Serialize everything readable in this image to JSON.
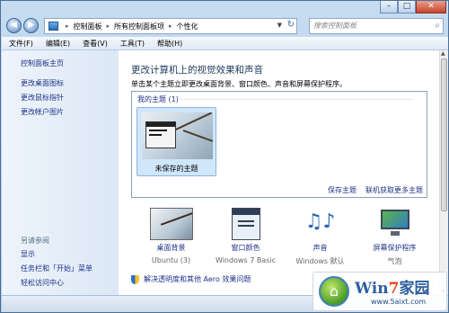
{
  "window": {
    "buttons": {
      "minimize": "–",
      "maximize": "□",
      "close": "✕"
    }
  },
  "address_bar": {
    "segments": [
      "控制面板",
      "所有控制面板项",
      "个性化"
    ],
    "separator": "▸",
    "refresh": "↻",
    "dropdown": "▼"
  },
  "nav": {
    "back": "◀",
    "forward": "▶"
  },
  "search": {
    "placeholder": "搜索控制面板",
    "icon": "⌕"
  },
  "menu": [
    "文件(F)",
    "编辑(E)",
    "查看(V)",
    "工具(T)",
    "帮助(H)"
  ],
  "sidebar": {
    "links": [
      "控制面板主页",
      "更改桌面图标",
      "更改鼠标指针",
      "更改帐户图片"
    ],
    "see_also": {
      "heading": "另请参阅",
      "links": [
        "显示",
        "任务栏和「开始」菜单",
        "轻松访问中心"
      ]
    }
  },
  "main": {
    "title": "更改计算机上的视觉效果和声音",
    "description": "单击某个主题立即更改桌面背景、窗口颜色、声音和屏幕保护程序。",
    "themes": {
      "group_label": "我的主题 (1)",
      "items": [
        {
          "label": "未保存的主题",
          "selected": true
        }
      ],
      "save_link": "保存主题",
      "more_link": "联机获取更多主题"
    },
    "settings": [
      {
        "title": "桌面背景",
        "value": "Ubuntu (3)",
        "icon": "desktop-background-icon"
      },
      {
        "title": "窗口颜色",
        "value": "Windows 7 Basic",
        "icon": "window-color-icon"
      },
      {
        "title": "声音",
        "value": "Windows 默认",
        "icon": "sounds-icon"
      },
      {
        "title": "屏幕保护程序",
        "value": "气泡",
        "icon": "screensaver-icon"
      }
    ],
    "troubleshoot_link": "解决透明度和其他 Aero 效果问题"
  },
  "watermark": {
    "brand_prefix": "Win",
    "brand_num": "7",
    "brand_suffix": "家园",
    "site": "www.5aixt.com"
  },
  "colors": {
    "link": "#1e3287",
    "heading": "#1e395b",
    "chrome": "#a9c9e9"
  }
}
